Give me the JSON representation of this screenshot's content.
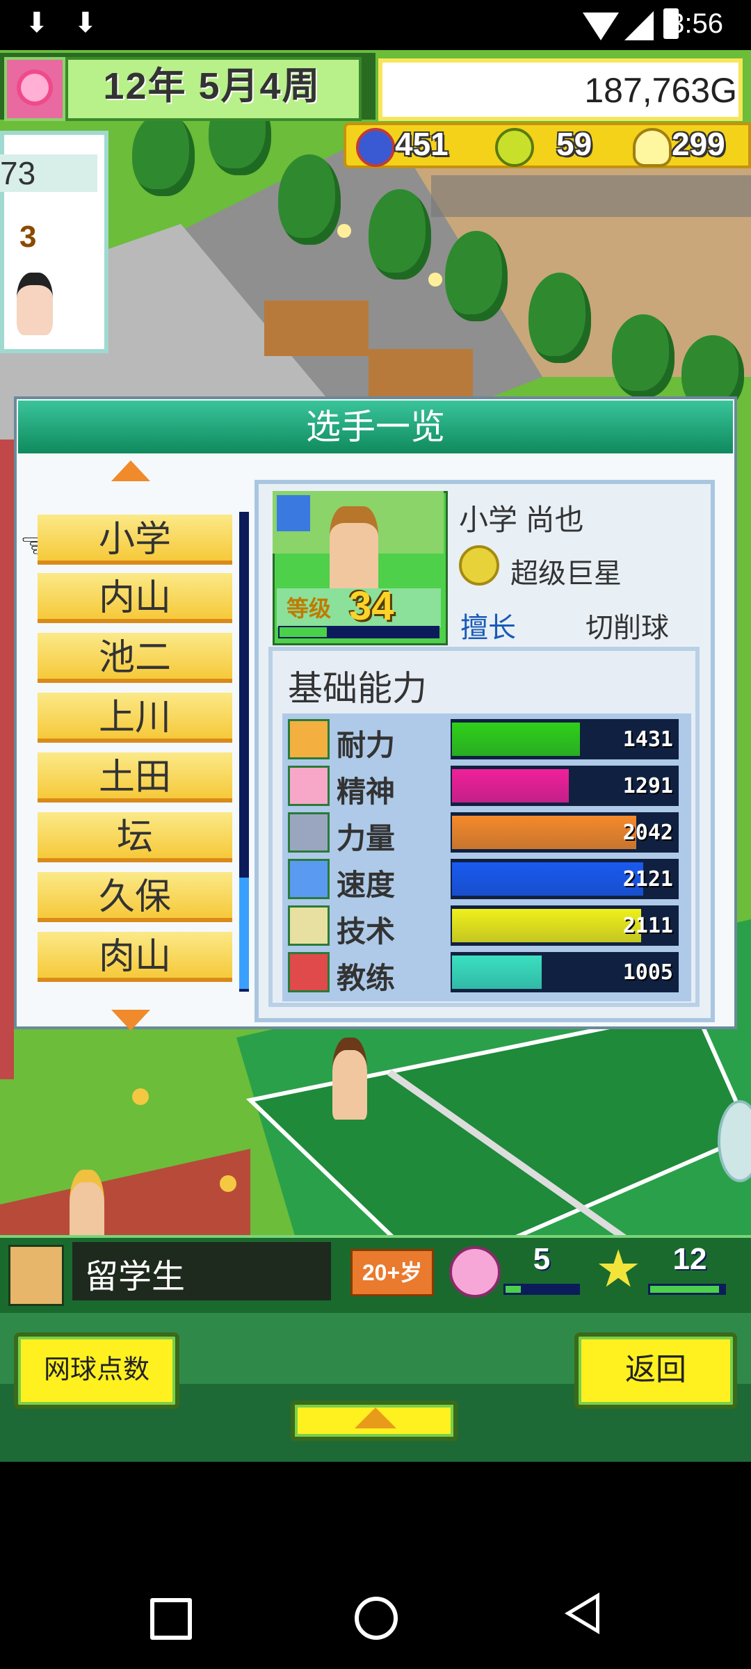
{
  "status_bar": {
    "time": "3:56",
    "download_icons": [
      "download-icon",
      "download-icon"
    ]
  },
  "hud": {
    "date": "12年 5月4周",
    "gold": "187,763G",
    "resources": [
      {
        "name": "shield-icon",
        "value": "451",
        "color": "#3a5ad4"
      },
      {
        "name": "tennis-ball-icon",
        "value": "59",
        "color": "#c8e02a"
      },
      {
        "name": "lightbulb-icon",
        "value": "299",
        "color": "#f7e65a"
      }
    ]
  },
  "side_card": {
    "value1": "73",
    "value2": "3"
  },
  "panel": {
    "title": "选手一览",
    "players": [
      "小学",
      "内山",
      "池二",
      "上川",
      "土田",
      "坛",
      "久保",
      "肉山"
    ],
    "selected_index": 0
  },
  "player_detail": {
    "name": "小学 尚也",
    "rank": "超级巨星",
    "specialty_label": "擅长",
    "specialty_value": "切削球",
    "level_label": "等级",
    "level": "34",
    "exp_fraction": 0.3
  },
  "stats": {
    "title": "基础能力",
    "max": 2500,
    "items": [
      {
        "label": "耐力",
        "value": "1431",
        "fraction": 0.57,
        "color": "#2fd01a",
        "icon": "muscle-icon",
        "icon_color": "#f3b040"
      },
      {
        "label": "精神",
        "value": "1291",
        "fraction": 0.52,
        "color": "#f0209a",
        "icon": "heart-icon",
        "icon_color": "#f7a8c8"
      },
      {
        "label": "力量",
        "value": "2042",
        "fraction": 0.82,
        "color": "#f58a2a",
        "icon": "dumbbell-icon",
        "icon_color": "#9aa6c0"
      },
      {
        "label": "速度",
        "value": "2121",
        "fraction": 0.85,
        "color": "#1a5af0",
        "icon": "runner-icon",
        "icon_color": "#5a9af0"
      },
      {
        "label": "技术",
        "value": "2111",
        "fraction": 0.84,
        "color": "#f0f01a",
        "icon": "racket-icon",
        "icon_color": "#e8e0a0"
      },
      {
        "label": "教练",
        "value": "1005",
        "fraction": 0.4,
        "color": "#3ae0c0",
        "icon": "whistle-icon",
        "icon_color": "#e04a4a"
      }
    ]
  },
  "selected_player": {
    "name": "留学生",
    "age_badge": "20+岁",
    "mood": "5",
    "stars": "12"
  },
  "controls": {
    "points_button": "网球点数",
    "back_button": "返回"
  }
}
